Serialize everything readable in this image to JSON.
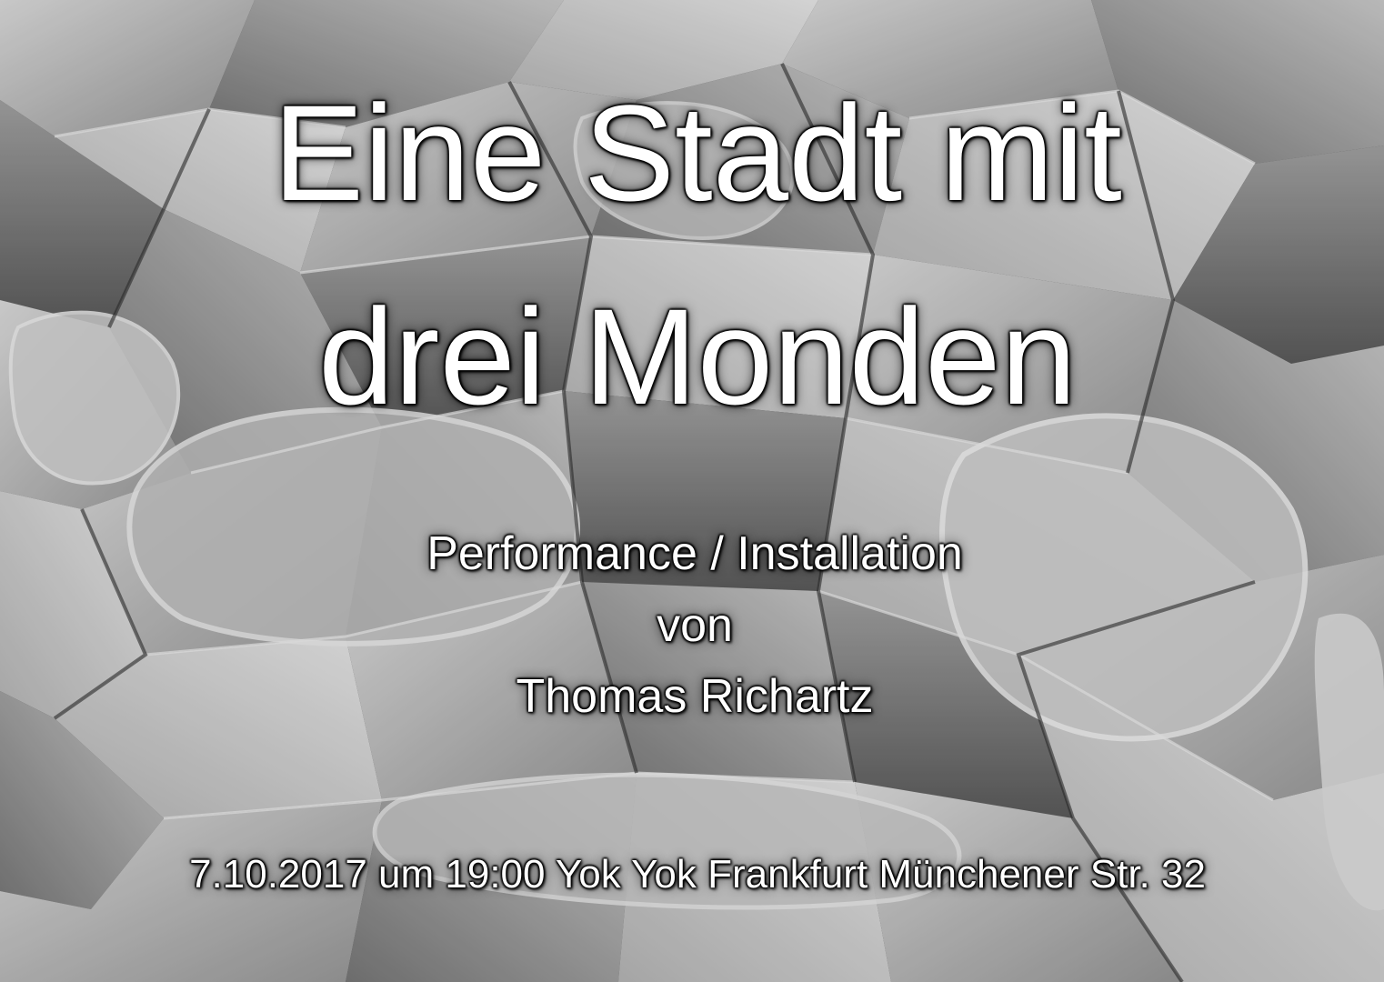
{
  "poster": {
    "title_line_1": "Eine Stadt mit",
    "title_line_2": "drei Monden",
    "subtitle_line_1": "Performance / Installation",
    "subtitle_line_2": "von",
    "subtitle_line_3": "Thomas Richartz",
    "event_info": "7.10.2017 um 19:00  Yok Yok Frankfurt Münchener Str. 32"
  },
  "background": {
    "subject": "broken white porcelain shards, black and white photograph"
  }
}
